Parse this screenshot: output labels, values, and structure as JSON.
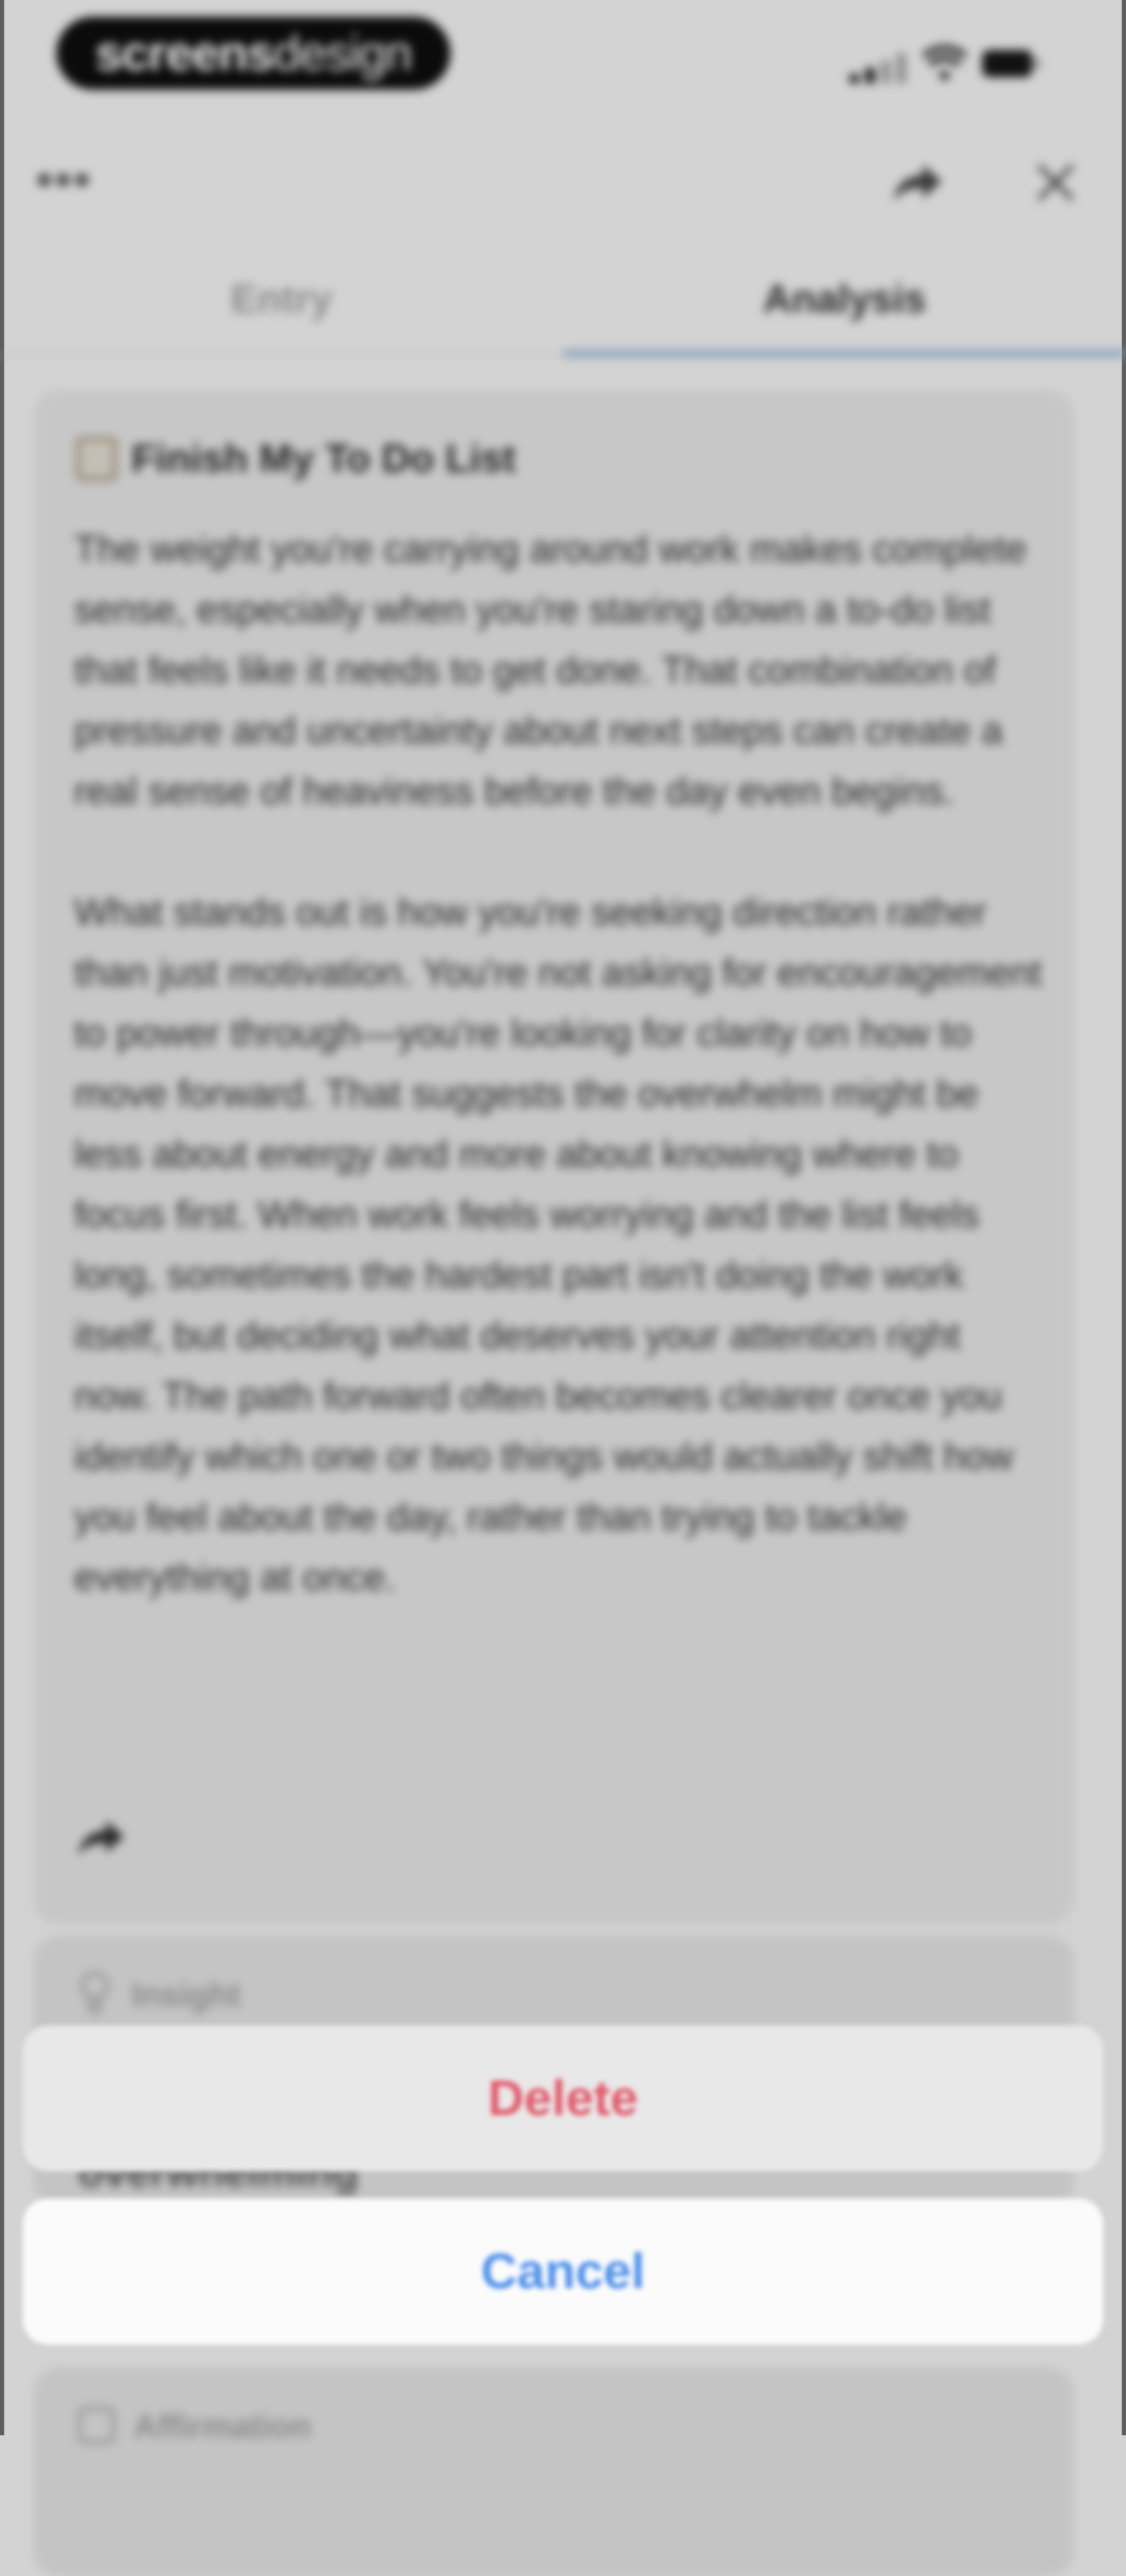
{
  "status_bar": {
    "logo_bold": "screens",
    "logo_light": "design"
  },
  "tabs": [
    {
      "label": "Entry",
      "selected": false
    },
    {
      "label": "Analysis",
      "selected": true
    }
  ],
  "card": {
    "title": "Finish My To Do List",
    "icon": "notepad-icon",
    "body": "The weight you're carrying around work makes complete sense, especially when you're staring down a to-do list that feels like it needs to get done. That combination of pressure and uncertainty about next steps can create a real sense of heaviness before the day even begins.\n\nWhat stands out is how you're seeking direction rather than just motivation. You're not asking for encouragement to power through—you're looking for clarity on how to move forward. That suggests the overwhelm might be less about energy and more about knowing where to focus first. When work feels worrying and the list feels long, sometimes the hardest part isn't doing the work itself, but deciding what deserves your attention right now. The path forward often becomes clearer once you identify which one or two things would actually shift how you feel about the day, rather than trying to tackle everything at once."
  },
  "insight_card": {
    "label": "Insight",
    "text": "overwhelming"
  },
  "affirmation_card": {
    "label": "Affirmation"
  },
  "action_sheet": {
    "delete_label": "Delete",
    "cancel_label": "Cancel"
  },
  "colors": {
    "delete": "#e35a6b",
    "cancel": "#4d90ec",
    "tab_underline": "#7f9bb7"
  }
}
